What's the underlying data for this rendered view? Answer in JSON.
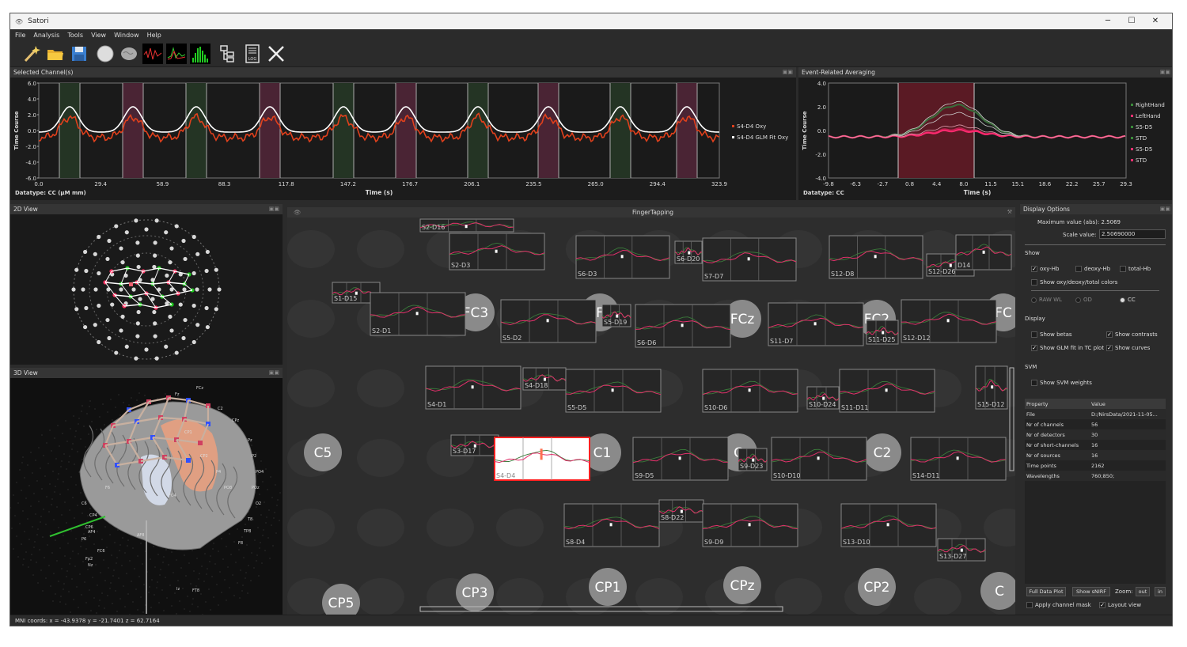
{
  "window": {
    "title": "Satori",
    "minimize": "─",
    "maximize": "☐",
    "close": "✕"
  },
  "menu": [
    "File",
    "Analysis",
    "Tools",
    "View",
    "Window",
    "Help"
  ],
  "toolbar": {
    "log_label": "LOG"
  },
  "selected_channel": {
    "title": "Selected Channel(s)",
    "ylabel": "Time Course",
    "xlabel": "Time (s)",
    "datatype": "Datatype: CC (µM mm)",
    "yticks": [
      "6.0",
      "4.0",
      "2.0",
      "0.0",
      "-2.0",
      "-4.0",
      "-6.0"
    ],
    "xticks": [
      "0.0",
      "29.4",
      "58.9",
      "88.3",
      "117.8",
      "147.2",
      "176.7",
      "206.1",
      "235.5",
      "265.0",
      "294.4",
      "323.9"
    ],
    "legend": [
      "S4-D4 Oxy",
      "S4-D4 GLM Fit Oxy"
    ]
  },
  "era": {
    "title": "Event-Related Averaging",
    "ylabel": "Time Course",
    "xlabel": "Time (s)",
    "datatype": "Datatype: CC",
    "yticks": [
      "4.0",
      "2.0",
      "0.0",
      "-2.0",
      "-4.0"
    ],
    "xticks": [
      "-9.8",
      "-6.3",
      "-2.7",
      "0.8",
      "4.4",
      "8.0",
      "11.5",
      "15.1",
      "18.6",
      "22.2",
      "25.7",
      "29.3"
    ],
    "legend": [
      "RightHand",
      "LeftHand",
      "S5-D5",
      "STD",
      "S5-D5",
      "STD"
    ]
  },
  "view2d": {
    "title": "2D View"
  },
  "view3d": {
    "title": "3D View",
    "labels": [
      "Fz",
      "FCz",
      "C2",
      "CP1",
      "CPz",
      "Pz",
      "P2",
      "PO4",
      "POz",
      "FC4",
      "F6",
      "C6",
      "CP4",
      "CP6",
      "P6",
      "FT8",
      "AF8",
      "Fp2",
      "Nz",
      "Iz",
      "O2",
      "T8",
      "TP8",
      "F8",
      "AF4",
      "FC6",
      "CP2",
      "P4",
      "PO8"
    ]
  },
  "layout": {
    "title": "FingerTapping",
    "electrodes": [
      "FC3",
      "FCz",
      "FC2",
      "FC",
      "C5",
      "C1",
      "C2",
      "C",
      "CP5",
      "CP3",
      "CP1",
      "CPz",
      "CP2",
      "C",
      "F"
    ],
    "channels": [
      "S2-D16",
      "S2-D3",
      "S6-D3",
      "S6-D20",
      "S7-D7",
      "S12-D8",
      "S12-D26",
      "D14",
      "S1-D15",
      "S2-D1",
      "S5-D2",
      "S5-D19",
      "S6-D6",
      "S11-D7",
      "S11-D25",
      "S12-D12",
      "S4-D1",
      "S4-D18",
      "S5-D5",
      "S10-D6",
      "S10-D24",
      "S11-D11",
      "S15-D12",
      "S3-D17",
      "S4-D4",
      "S9-D5",
      "S9-D23",
      "S10-D10",
      "S14-D11",
      "S8-D22",
      "S8-D4",
      "S9-D9",
      "S13-D10",
      "S13-D27"
    ]
  },
  "display_options": {
    "title": "Display Options",
    "max_value_label": "Maximum value (abs):",
    "max_value": "2.5069",
    "scale_value_label": "Scale value:",
    "scale_value": "2.50690000",
    "show_header": "Show",
    "oxy": "oxy-Hb",
    "deoxy": "deoxy-Hb",
    "total": "total-Hb",
    "show_oxy_deoxy_total": "Show oxy/deoxy/total colors",
    "raw_wl": "RAW WL",
    "od": "OD",
    "cc": "CC",
    "display_header": "Display",
    "show_betas": "Show betas",
    "show_contrasts": "Show contrasts",
    "show_glm_fit": "Show GLM fit in TC plot",
    "show_curves": "Show curves",
    "svm_header": "SVM",
    "show_svm_weights": "Show SVM weights",
    "full_data_plot": "Full Data Plot",
    "show_snirf": "Show sNIRF",
    "zoom_label": "Zoom:",
    "zoom_out": "out",
    "zoom_in": "in",
    "apply_channel_mask": "Apply channel mask",
    "layout_view": "Layout view"
  },
  "properties": {
    "header": [
      "Property",
      "Value"
    ],
    "rows": [
      [
        "File",
        "D:/NirsData/2021-11-05..."
      ],
      [
        "Nr of channels",
        "56"
      ],
      [
        "Nr of detectors",
        "30"
      ],
      [
        "Nr of short-channels",
        "16"
      ],
      [
        "Nr of sources",
        "16"
      ],
      [
        "Time points",
        "2162"
      ],
      [
        "Wavelengths",
        "760;850;"
      ]
    ]
  },
  "status": "MNI coords: x = -43.9378 y = -21.7401 z = 62.7164"
}
